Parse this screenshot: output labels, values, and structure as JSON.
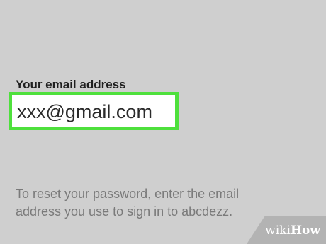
{
  "form": {
    "email_label": "Your email address",
    "email_value": "xxx@gmail.com",
    "instructions_line1": "To reset your password, enter the email",
    "instructions_line2": "address you use to sign in to abcdezz."
  },
  "watermark": {
    "wiki": "wiki",
    "how": "How"
  },
  "colors": {
    "background": "#cfcfcf",
    "highlight": "#4ee03c",
    "label_text": "#1f1f1f",
    "instruction_text": "#7a7a7a"
  }
}
